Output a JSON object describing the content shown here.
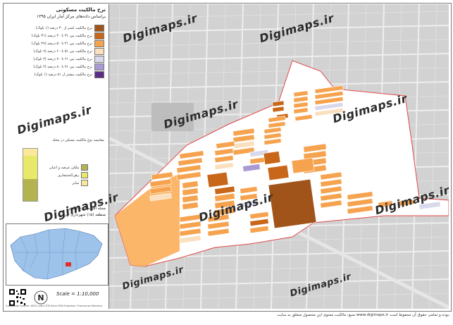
{
  "title": {
    "line1": "نرخ مالکیت مسکونی",
    "line2": "براساس داده‌های مرکز آمار ایران ۱۳۹۵"
  },
  "legend": {
    "items": [
      {
        "label": "نرخ مالکیت کمتر از ۳۰ درصد (۱ بلوک)",
        "color": "#a1541a"
      },
      {
        "label": "نرخ مالکیت بین ۳۱ تا ۴۰ درصد (۳۱ بلوک)",
        "color": "#c8661a"
      },
      {
        "label": "نرخ مالکیت بین ۴۱ تا ۵۰ درصد (۲۹ بلوک)",
        "color": "#f6a34f"
      },
      {
        "label": "نرخ مالکیت بین ۵۱ تا ۶۰ درصد (۹ بلوک)",
        "color": "#fbe0c0"
      },
      {
        "label": "نرخ مالکیت بین ۶۱ تا ۷۰ درصد (۲ بلوک)",
        "color": "#d9d9ec"
      },
      {
        "label": "نرخ مالکیت بین ۷۱ تا ۸۰ درصد (۲ بلوک)",
        "color": "#a99ad4"
      },
      {
        "label": "نرخ مالکیت بیشتر از ۸۱ درصد (۱ بلوک)",
        "color": "#5b2d86"
      }
    ]
  },
  "chart_data": {
    "type": "bar",
    "title": "مقایسه نوع مالکیت مسکن در محله",
    "categories": [
      "ملکی عرصه و اعیان",
      "رهن/استیجاری",
      "سایر"
    ],
    "colors": [
      "#b3b350",
      "#e8e86a",
      "#fbe89a"
    ],
    "values": [
      0.42,
      0.45,
      0.13
    ]
  },
  "location": {
    "line1": "محله اسلام آباد-ولیعصر",
    "line2": "منطقه (۱۵) شهرداری تهران"
  },
  "scale": "Scale = 1:10,000",
  "credit": "Coordinate System: WGS 1984 UTM Zone 39N  Projection: Transverse Mercator",
  "footer": "منبع: مالکیت معنوی این محصول متعلق به سایت www.digimaps.ir بوده و تمامی حقوق آن محفوظ است.",
  "watermarks": [
    "Digimaps.ir",
    "Digimaps.ir",
    "Digimaps.ir",
    "Digimaps.ir",
    "Digimaps.ir",
    "Digimaps.ir",
    "Digimaps.ir",
    "Digimaps.ir",
    "Digimaps.ir",
    "Digimaps.ir"
  ]
}
